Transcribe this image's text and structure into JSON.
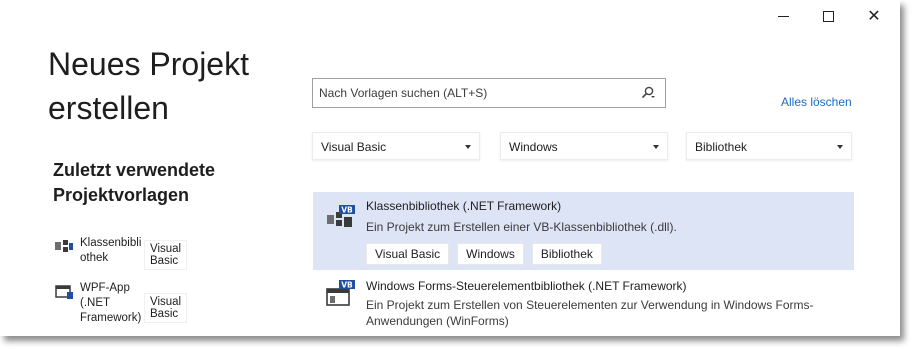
{
  "window": {
    "controls": {
      "minimize": "minimize-icon",
      "maximize": "maximize-icon",
      "close": "close-icon"
    },
    "close_glyph": "✕"
  },
  "page": {
    "title_line1": "Neues Projekt",
    "title_line2": "erstellen"
  },
  "recent": {
    "heading_line1": "Zuletzt verwendete",
    "heading_line2": "Projektvorlagen",
    "items": [
      {
        "name_lines": [
          "Klassenbibli",
          "othek"
        ],
        "language": "Visual Basic",
        "icon": "class-library-icon"
      },
      {
        "name_lines": [
          "WPF-App",
          "(.NET",
          "Framework)"
        ],
        "language": "Visual Basic",
        "icon": "wpf-app-icon"
      }
    ]
  },
  "search": {
    "placeholder": "Nach Vorlagen suchen (ALT+S)",
    "value": "",
    "icon": "search-icon"
  },
  "clear_all": "Alles löschen",
  "filters": {
    "language": "Visual Basic",
    "platform": "Windows",
    "project_type": "Bibliothek"
  },
  "templates": [
    {
      "name": "Klassenbibliothek (.NET Framework)",
      "description": "Ein Projekt zum Erstellen einer VB-Klassenbibliothek (.dll).",
      "tags": [
        "Visual Basic",
        "Windows",
        "Bibliothek"
      ],
      "icon": "vb-class-library-icon",
      "selected": true
    },
    {
      "name": "Windows Forms-Steuerelementbibliothek (.NET Framework)",
      "description": "Ein Projekt zum Erstellen von Steuerelementen zur Verwendung in Windows Forms-Anwendungen (WinForms)",
      "tags": [],
      "icon": "vb-winforms-control-library-icon",
      "selected": false
    }
  ],
  "colors": {
    "accent_link": "#1b6ac9",
    "selected_row": "#dde4f6",
    "vb_badge": "#1e4fa0"
  }
}
